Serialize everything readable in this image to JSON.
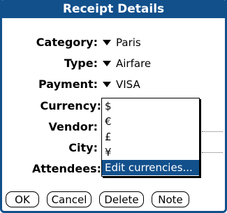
{
  "dialog": {
    "title": "Receipt Details"
  },
  "fields": {
    "category": {
      "label": "Category:",
      "value": "Paris"
    },
    "type": {
      "label": "Type:",
      "value": "Airfare"
    },
    "payment": {
      "label": "Payment:",
      "value": "VISA"
    },
    "currency": {
      "label": "Currency:"
    },
    "vendor": {
      "label": "Vendor:"
    },
    "city": {
      "label": "City:"
    },
    "attendees": {
      "label": "Attendees:"
    }
  },
  "currency_popup": {
    "items": [
      "$",
      "€",
      "£",
      "¥",
      "Edit currencies..."
    ],
    "selected_index": 4
  },
  "buttons": {
    "ok": "OK",
    "cancel": "Cancel",
    "delete": "Delete",
    "note": "Note"
  },
  "colors": {
    "accent": "#12508c"
  }
}
